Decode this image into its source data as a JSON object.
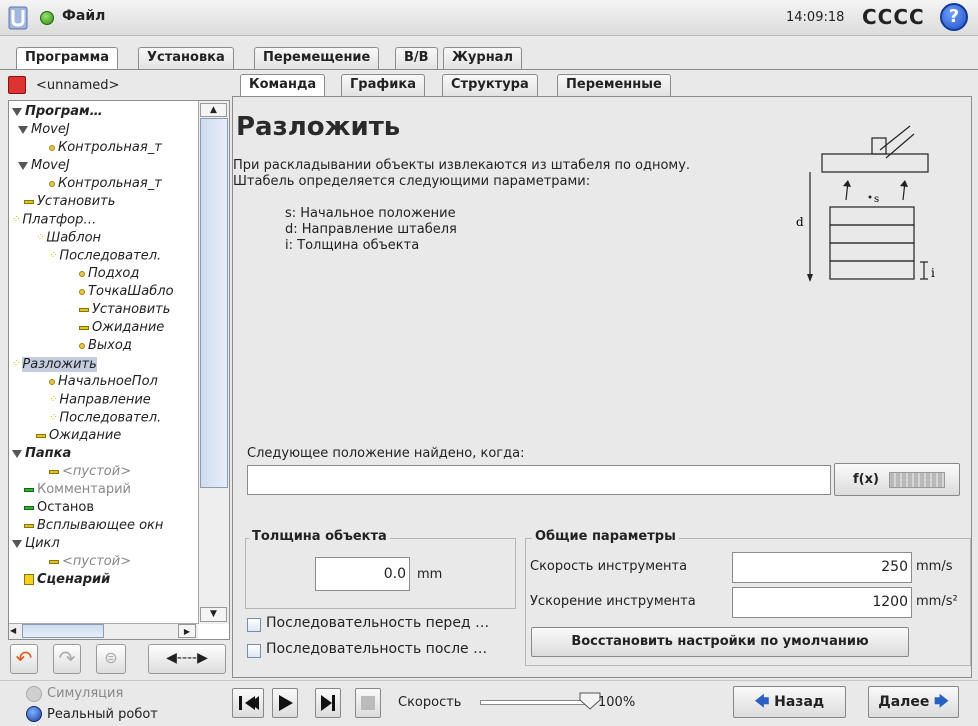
{
  "topbar": {
    "file_label": "Файл",
    "clock": "14:09:18",
    "robot_name": "CCCC",
    "help": "?"
  },
  "main_tabs": [
    "Программа",
    "Установка",
    "Перемещение",
    "В/В",
    "Журнал"
  ],
  "program": {
    "name": "<unnamed>"
  },
  "tree": [
    {
      "label": "Програм…"
    },
    {
      "label": "MoveJ"
    },
    {
      "label": "Контрольная_т"
    },
    {
      "label": "MoveJ"
    },
    {
      "label": "Контрольная_т"
    },
    {
      "label": "Установить"
    },
    {
      "label": "Платфор…"
    },
    {
      "label": "Шаблон"
    },
    {
      "label": "Последовател."
    },
    {
      "label": "Подход"
    },
    {
      "label": "ТочкаШабло"
    },
    {
      "label": "Установить"
    },
    {
      "label": "Ожидание"
    },
    {
      "label": "Выход"
    },
    {
      "label": "Разложить"
    },
    {
      "label": "НачальноеПол"
    },
    {
      "label": "Направление"
    },
    {
      "label": "Последовател."
    },
    {
      "label": "Ожидание"
    },
    {
      "label": "Папка"
    },
    {
      "label": "<пустой>"
    },
    {
      "label": "Комментарий"
    },
    {
      "label": "Останов"
    },
    {
      "label": "Всплывающее окн"
    },
    {
      "label": "Цикл"
    },
    {
      "label": "<пустой>"
    },
    {
      "label": "Сценарий"
    }
  ],
  "sub_tabs": [
    "Команда",
    "Графика",
    "Структура",
    "Переменные"
  ],
  "command": {
    "title": "Разложить",
    "desc_line1": "При раскладывании объекты извлекаются из штабеля по одному.",
    "desc_line2": "Штабель определяется следующими параметрами:",
    "param_s": "s: Начальное положение",
    "param_d": "d: Направление штабеля",
    "param_i": "i: Толщина объекта",
    "diagram_d": "d",
    "diagram_s": "s",
    "diagram_i": "i",
    "next_pos_label": "Следующее положение найдено, когда:",
    "next_pos_value": "",
    "fx_label": "f(x)"
  },
  "thickness": {
    "title": "Толщина объекта",
    "value": "0.0",
    "unit": "mm"
  },
  "checkboxes": [
    {
      "label": "Последовательность перед …",
      "checked": false
    },
    {
      "label": "Последовательность после …",
      "checked": false
    }
  ],
  "general": {
    "title": "Общие параметры",
    "tool_speed_label": "Скорость инструмента",
    "tool_speed_value": "250",
    "tool_speed_unit": "mm/s",
    "tool_accel_label": "Ускорение инструмента",
    "tool_accel_value": "1200",
    "tool_accel_unit": "mm/s²",
    "restore_label": "Восстановить настройки по умолчанию"
  },
  "bottom": {
    "simulation": "Симуляция",
    "real_robot": "Реальный робот",
    "speed_label": "Скорость",
    "speed_value": "100%",
    "speed_fraction": 1.0,
    "back_label": "Назад",
    "next_label": "Далее"
  },
  "colors": {
    "accent": "#2a5fc4",
    "selection": "#c4cde0"
  }
}
